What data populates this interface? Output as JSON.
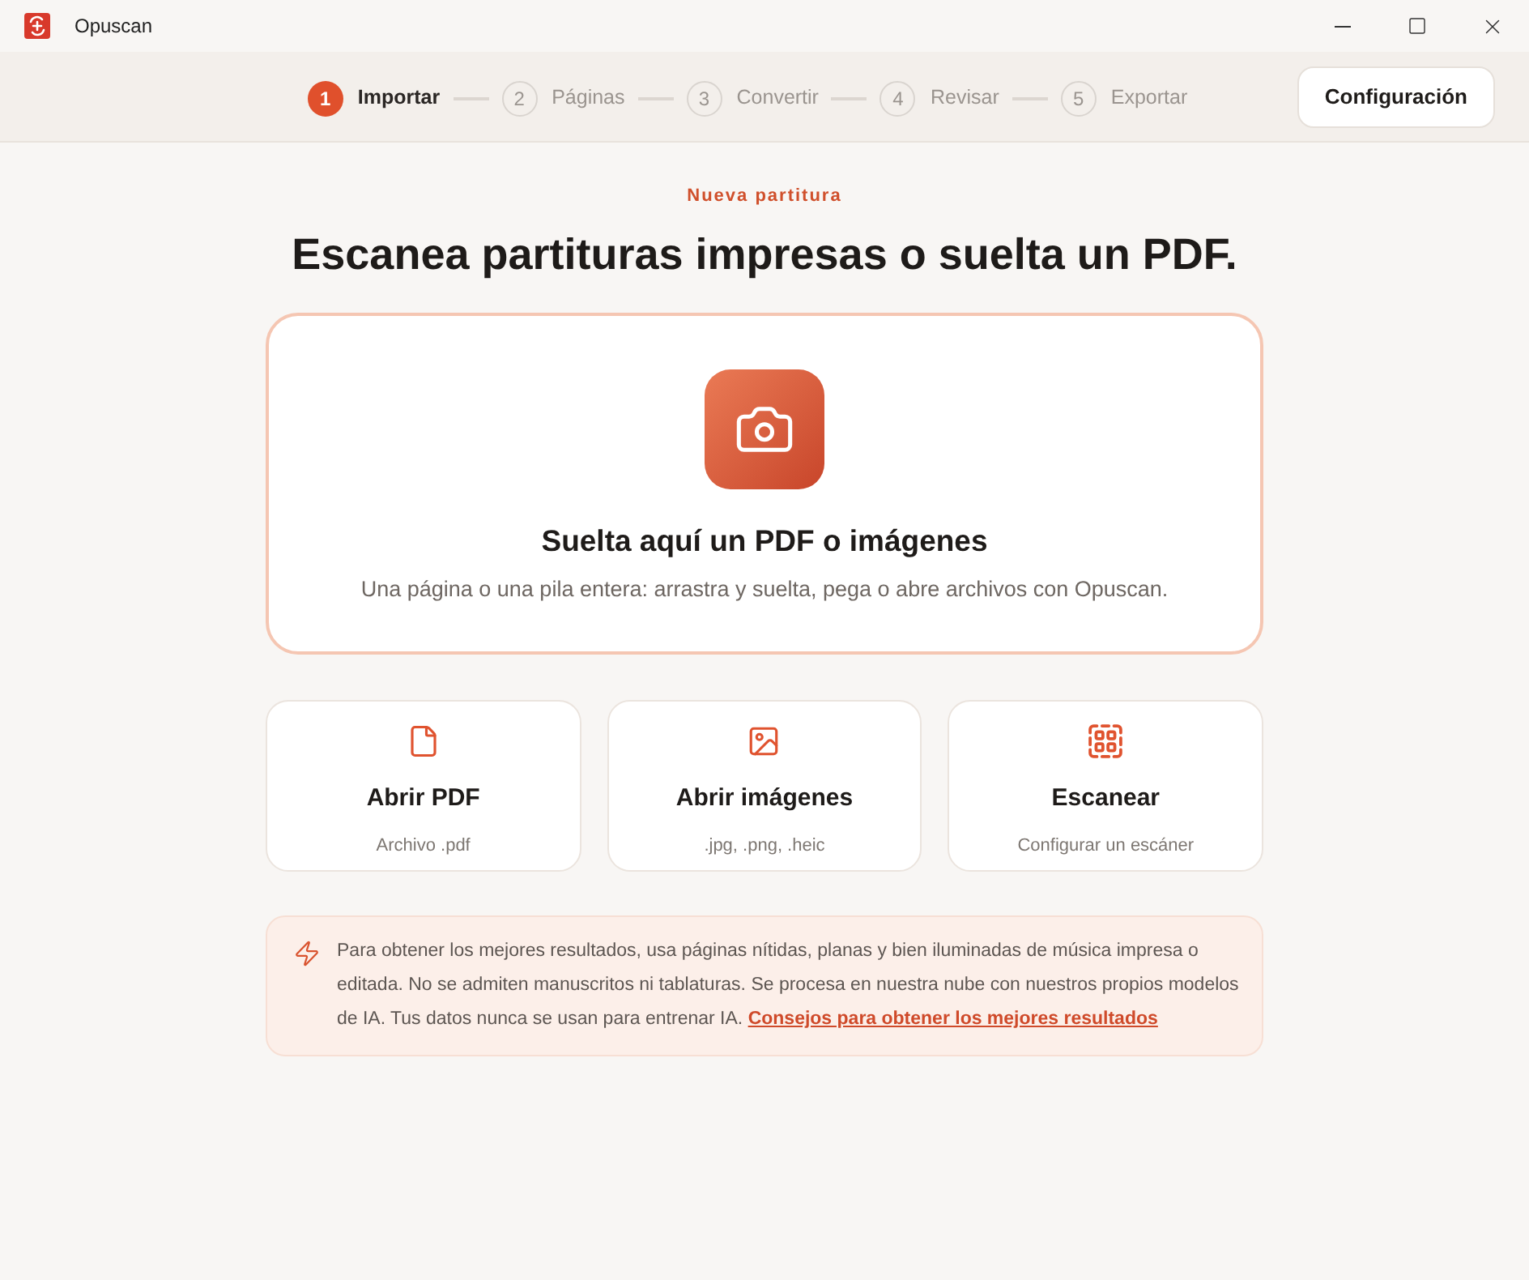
{
  "window": {
    "title": "Opuscan"
  },
  "stepper": {
    "steps": [
      {
        "number": "1",
        "label": "Importar",
        "selected": true
      },
      {
        "number": "2",
        "label": "Páginas",
        "selected": false
      },
      {
        "number": "3",
        "label": "Convertir",
        "selected": false
      },
      {
        "number": "4",
        "label": "Revisar",
        "selected": false
      },
      {
        "number": "5",
        "label": "Exportar",
        "selected": false
      }
    ]
  },
  "settings_button": {
    "label": "Configuración"
  },
  "eyebrow": "Nueva partitura",
  "heading": "Escanea partituras impresas o suelta un PDF.",
  "drop_zone": {
    "title": "Suelta aquí un PDF o imágenes",
    "subtitle": "Una página o una pila entera: arrastra y suelta, pega o abre archivos con Opuscan."
  },
  "actions": [
    {
      "kind": "pdf",
      "title": "Abrir PDF",
      "subtitle": "Archivo .pdf"
    },
    {
      "kind": "images",
      "title": "Abrir imágenes",
      "subtitle": ".jpg, .png, .heic"
    },
    {
      "kind": "scan",
      "title": "Escanear",
      "subtitle": "Configurar un escáner"
    }
  ],
  "tip": {
    "text": "Para obtener los mejores resultados, usa páginas nítidas, planas y bien iluminadas de música impresa o editada. No se admiten manuscritos ni tablaturas. Se procesa en nuestra nube con nuestros propios modelos de IA. Tus datos nunca se usan para entrenar IA.",
    "link": "Consejos para obtener los mejores resultados"
  }
}
